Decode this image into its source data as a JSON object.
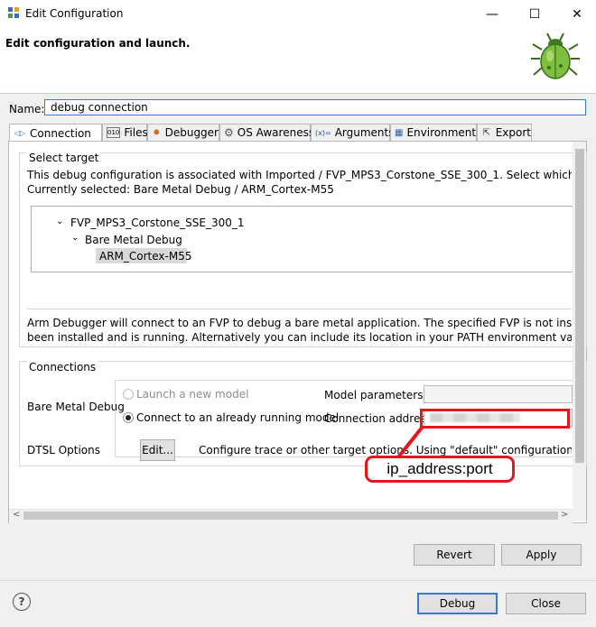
{
  "window": {
    "title": "Edit Configuration",
    "minimize_glyph": "—",
    "maximize_glyph": "☐",
    "close_glyph": "✕"
  },
  "header": {
    "title": "Edit configuration and launch."
  },
  "name": {
    "label": "Name:",
    "value": "debug connection"
  },
  "tabs": [
    {
      "label": "Connection",
      "icon": "connection-icon"
    },
    {
      "label": "Files",
      "icon": "files-icon"
    },
    {
      "label": "Debugger",
      "icon": "debugger-icon"
    },
    {
      "label": "OS Awareness",
      "icon": "gear-icon"
    },
    {
      "label": "Arguments",
      "icon": "arguments-icon"
    },
    {
      "label": "Environment",
      "icon": "environment-icon"
    },
    {
      "label": "Export",
      "icon": "export-icon"
    }
  ],
  "tab_icon_glyphs": {
    "connection": "◁▷",
    "files": "010",
    "debugger": "✹",
    "os": "⚙",
    "arguments": "(x)=",
    "environment": "▦",
    "export": "⇱"
  },
  "select_target": {
    "group_label": "Select target",
    "description_line1": "This debug configuration is associated with Imported / FVP_MPS3_Corstone_SSE_300_1. Select which debug operation",
    "description_line2": "Currently selected: Bare Metal Debug / ARM_Cortex-M55",
    "tree": {
      "root": "FVP_MPS3_Corstone_SSE_300_1",
      "child": "Bare Metal Debug",
      "leaf": "ARM_Cortex-M55",
      "expand_glyph": "⌄"
    },
    "info_line1": "Arm Debugger will connect to an FVP to debug a bare metal application. The specified FVP is not installed as part of",
    "info_line2": "been installed and is running. Alternatively you can include its location in your PATH environment variable and Arm"
  },
  "connections": {
    "group_label": "Connections",
    "bare_metal_label": "Bare Metal Debug",
    "radio_launch": "Launch a new model",
    "radio_connect": "Connect to an already running model",
    "model_params_label": "Model parameters",
    "connection_address_label": "Connection address",
    "dtsl_label": "DTSL Options",
    "dtsl_button": "Edit...",
    "dtsl_description": "Configure  trace or other target options. Using \"default\" configuration options"
  },
  "annotation": {
    "text": "ip_address:port",
    "color": "#e8141c"
  },
  "scroll": {
    "left_arrow": "<",
    "right_arrow": ">",
    "up_arrow": "˄",
    "down_arrow": "˅"
  },
  "buttons": {
    "revert": "Revert",
    "apply": "Apply",
    "debug": "Debug",
    "close": "Close",
    "help": "?"
  },
  "colors": {
    "accent": "#3c78d8",
    "annotation_red": "#e8141c"
  }
}
